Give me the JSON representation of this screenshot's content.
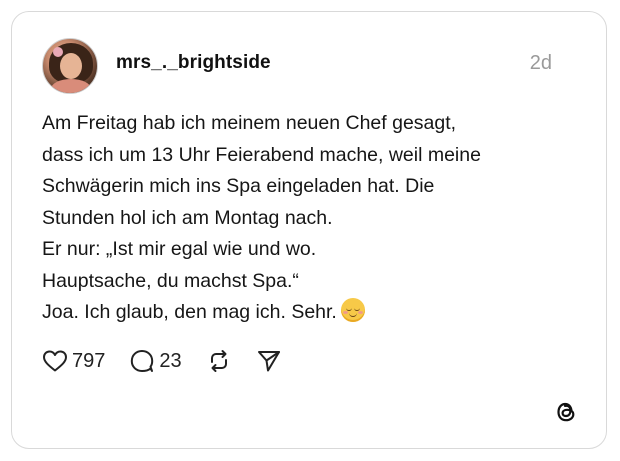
{
  "post": {
    "username": "mrs_._brightside",
    "time": "2d",
    "lines": [
      "Am Freitag hab ich meinem neuen Chef gesagt,",
      "dass ich um 13 Uhr Feierabend mache, weil meine",
      "Schwägerin mich ins Spa eingeladen hat. Die",
      "Stunden hol ich am Montag nach.",
      "Er nur: „Ist mir egal wie und wo.",
      "Hauptsache, du machst Spa.“",
      "Joa. Ich glaub, den mag ich. Sehr."
    ],
    "emoji": "relieved-face-emoji"
  },
  "actions": {
    "likes": "797",
    "replies": "23"
  },
  "icons": {
    "like": "heart-icon",
    "reply": "comment-icon",
    "repost": "repost-icon",
    "share": "send-icon",
    "brand": "threads-logo-icon"
  },
  "colors": {
    "text": "#111111",
    "muted": "#9a9a9a",
    "border": "#d9d9d9"
  }
}
